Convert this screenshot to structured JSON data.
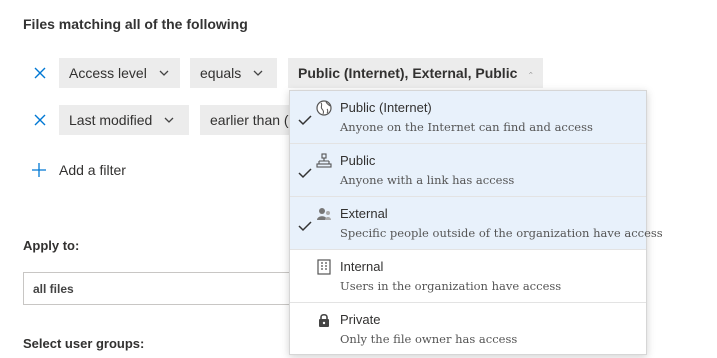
{
  "heading": "Files matching all of the following",
  "filters": [
    {
      "field": "Access level",
      "operator": "equals",
      "value": "Public (Internet), External, Public"
    },
    {
      "field": "Last modified",
      "operator": "earlier than ("
    }
  ],
  "add_filter_label": "Add a filter",
  "apply_to": {
    "label": "Apply to:",
    "value": "all files"
  },
  "select_user_groups_label": "Select user groups:",
  "dropdown": {
    "options": [
      {
        "title": "Public (Internet)",
        "desc": "Anyone on the Internet can find and access",
        "selected": true,
        "icon": "globe-icon"
      },
      {
        "title": "Public",
        "desc": "Anyone with a link has access",
        "selected": true,
        "icon": "share-link-icon"
      },
      {
        "title": "External",
        "desc": "Specific people outside of the organization have access",
        "selected": true,
        "icon": "external-people-icon"
      },
      {
        "title": "Internal",
        "desc": "Users in the organization have access",
        "selected": false,
        "icon": "building-icon"
      },
      {
        "title": "Private",
        "desc": "Only the file owner has access",
        "selected": false,
        "icon": "lock-icon"
      }
    ]
  },
  "colors": {
    "accent": "#0078d4",
    "selected_bg": "#e8f1fb",
    "pill_bg": "#ececec"
  }
}
